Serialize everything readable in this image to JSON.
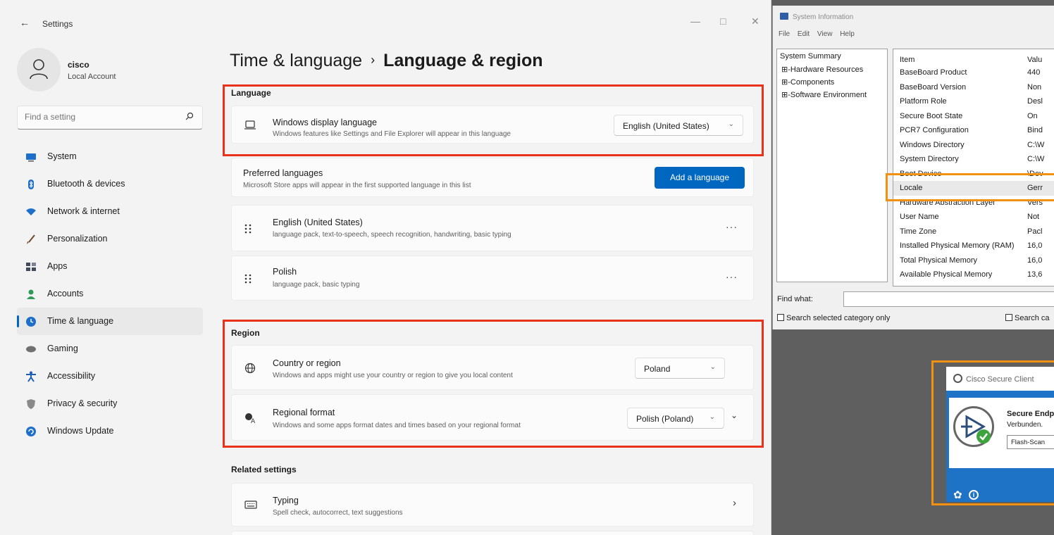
{
  "settings": {
    "app_title": "Settings",
    "user": {
      "name": "cisco",
      "account": "Local Account"
    },
    "search": {
      "placeholder": "Find a setting"
    },
    "nav": [
      {
        "label": "System",
        "icon": "monitor-icon",
        "color": "#1e6fc9"
      },
      {
        "label": "Bluetooth & devices",
        "icon": "bluetooth-icon",
        "color": "#1e6fc9"
      },
      {
        "label": "Network & internet",
        "icon": "wifi-icon",
        "color": "#1e6fc9"
      },
      {
        "label": "Personalization",
        "icon": "brush-icon",
        "color": "#6c4a2a"
      },
      {
        "label": "Apps",
        "icon": "apps-icon",
        "color": "#3f4a5c"
      },
      {
        "label": "Accounts",
        "icon": "person-icon",
        "color": "#2e9a56"
      },
      {
        "label": "Time & language",
        "icon": "globe-clock-icon",
        "color": "#1e6fc9",
        "active": true
      },
      {
        "label": "Gaming",
        "icon": "gamepad-icon",
        "color": "#707070"
      },
      {
        "label": "Accessibility",
        "icon": "accessibility-icon",
        "color": "#1e5fb3"
      },
      {
        "label": "Privacy & security",
        "icon": "shield-icon",
        "color": "#8a8a8a"
      },
      {
        "label": "Windows Update",
        "icon": "update-icon",
        "color": "#1e6fc9"
      }
    ],
    "breadcrumb": {
      "parent": "Time & language",
      "separator": "›",
      "current": "Language & region"
    },
    "language_section": "Language",
    "display_language": {
      "title": "Windows display language",
      "subtitle": "Windows features like Settings and File Explorer will appear in this language",
      "value": "English (United States)"
    },
    "preferred": {
      "title": "Preferred languages",
      "subtitle": "Microsoft Store apps will appear in the first supported language in this list",
      "button": "Add a language"
    },
    "languages": [
      {
        "title": "English (United States)",
        "subtitle": "language pack, text-to-speech, speech recognition, handwriting, basic typing"
      },
      {
        "title": "Polish",
        "subtitle": "language pack, basic typing"
      }
    ],
    "region_section": "Region",
    "country": {
      "title": "Country or region",
      "subtitle": "Windows and apps might use your country or region to give you local content",
      "value": "Poland"
    },
    "regional_format": {
      "title": "Regional format",
      "subtitle": "Windows and some apps format dates and times based on your regional format",
      "value": "Polish (Poland)"
    },
    "related_section": "Related settings",
    "typing": {
      "title": "Typing",
      "subtitle": "Spell check, autocorrect, text suggestions"
    },
    "more_glyph": "···",
    "chevron_glyph": "›",
    "dropdown_glyph": "⌄",
    "accent_color": "#0067c0",
    "highlight_color": "#e8321c"
  },
  "sysinfo": {
    "title": "System Information",
    "menu": [
      "File",
      "Edit",
      "View",
      "Help"
    ],
    "tree": {
      "root": "System Summary",
      "children": [
        "Hardware Resources",
        "Components",
        "Software Environment"
      ]
    },
    "columns": {
      "item": "Item",
      "value": "Valu"
    },
    "rows": [
      {
        "k": "BaseBoard Product",
        "v": "440"
      },
      {
        "k": "BaseBoard Version",
        "v": "Non"
      },
      {
        "k": "Platform Role",
        "v": "Desl"
      },
      {
        "k": "Secure Boot State",
        "v": "On"
      },
      {
        "k": "PCR7 Configuration",
        "v": "Bind"
      },
      {
        "k": "Windows Directory",
        "v": "C:\\W"
      },
      {
        "k": "System Directory",
        "v": "C:\\W"
      },
      {
        "k": "Boot Device",
        "v": "\\Dev"
      },
      {
        "k": "Locale",
        "v": "Gerr"
      },
      {
        "k": "Hardware Abstraction Layer",
        "v": "Vers"
      },
      {
        "k": "User Name",
        "v": "Not"
      },
      {
        "k": "Time Zone",
        "v": "Pacl"
      },
      {
        "k": "Installed Physical Memory (RAM)",
        "v": "16,0"
      },
      {
        "k": "Total Physical Memory",
        "v": "16,0"
      },
      {
        "k": "Available Physical Memory",
        "v": "13,6"
      }
    ],
    "find_label": "Find what:",
    "chk_selected": "Search selected category only",
    "chk_names": "Search ca",
    "highlight_color": "#f29111"
  },
  "cisco": {
    "title": "Cisco Secure Client",
    "status": "Secure Endp",
    "sub": "Verbunden.",
    "button": "Flash-Scan",
    "brand_color": "#1f73c6"
  }
}
